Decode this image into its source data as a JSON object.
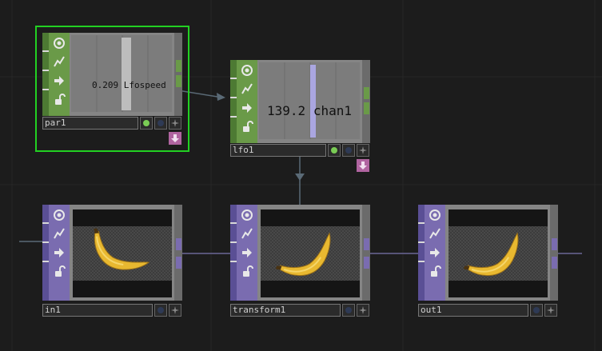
{
  "nodes": {
    "par1": {
      "name": "par1",
      "value": "0.209",
      "channel": "Lfospeed"
    },
    "lfo1": {
      "name": "lfo1",
      "value": "139.2",
      "channel": "chan1"
    },
    "in1": {
      "name": "in1"
    },
    "transform1": {
      "name": "transform1"
    },
    "out1": {
      "name": "out1"
    }
  },
  "colors": {
    "background": "#1c1c1c",
    "chop_family": "#6a9a48",
    "top_family": "#7a6cb0",
    "selected_outline": "#22d022",
    "viewer_active_dot": "#7acc55",
    "viewer_inactive_dot": "#2e3a55",
    "down_button": "#b064a0"
  },
  "icons": [
    "bypass-icon",
    "cook-icon",
    "pass-icon",
    "lock-icon",
    "viewer-toggle-icon",
    "clone-icon",
    "down-arrow-icon"
  ]
}
